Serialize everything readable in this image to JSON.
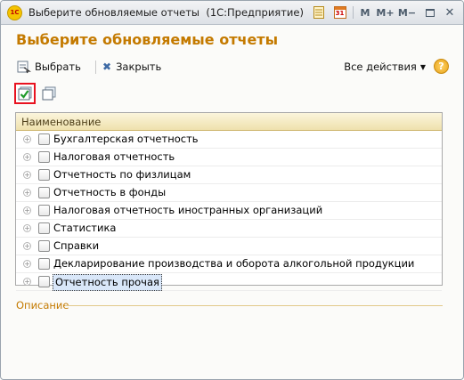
{
  "window": {
    "title": "Выберите обновляемые отчеты",
    "app": "(1С:Предприятие)",
    "app_icon_text": "1С",
    "titlebar_buttons": [
      "M",
      "M+",
      "M−"
    ],
    "calendar_day": "31"
  },
  "header": {
    "title": "Выберите обновляемые отчеты"
  },
  "toolbar": {
    "select_label": "Выбрать",
    "close_label": "Закрыть",
    "all_actions_label": "Все действия",
    "help_label": "?"
  },
  "table": {
    "column_header": "Наименование",
    "rows": [
      "Бухгалтерская отчетность",
      "Налоговая отчетность",
      "Отчетность по физлицам",
      "Отчетность в фонды",
      "Налоговая отчетность иностранных организаций",
      "Статистика",
      "Справки",
      "Декларирование производства и оборота алкогольной продукции",
      "Отчетность прочая"
    ],
    "selected_row": 8
  },
  "description": {
    "label": "Описание"
  },
  "colors": {
    "accent": "#c47a00",
    "highlight_border": "#e8121f",
    "selection": "#d9e7f9"
  }
}
